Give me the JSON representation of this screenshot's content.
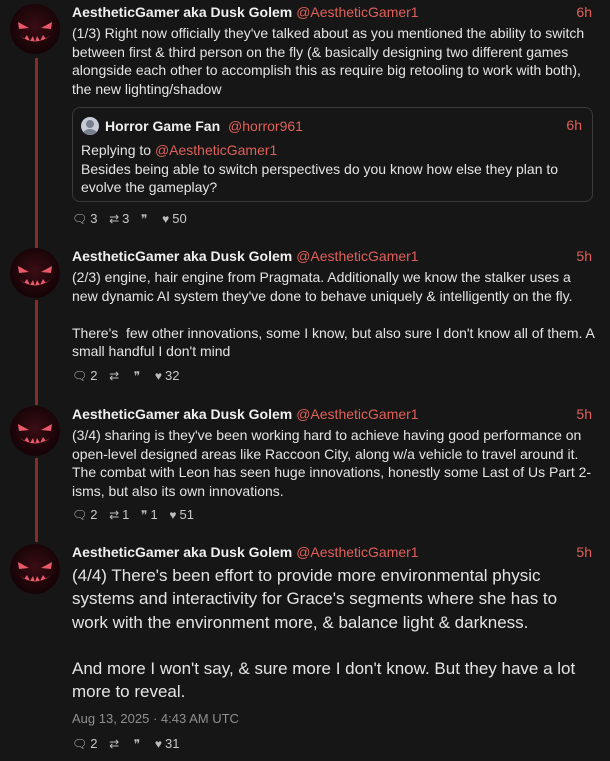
{
  "tweets": [
    {
      "name": "AestheticGamer aka Dusk Golem",
      "handle": "@AestheticGamer1",
      "time": "6h",
      "text": "(1/3) Right now officially they've talked about as you mentioned the ability to switch between first & third person on the fly (& basically designing two different games alongside each other to accomplish this as require big retooling to work with both), the new lighting/shadow",
      "quote": {
        "name": "Horror Game Fan",
        "handle": "@horror961",
        "time": "6h",
        "replying_label": "Replying to",
        "replying_handle": "@AestheticGamer1",
        "text": "Besides being able to switch perspectives do you know how else they plan to evolve the gameplay?"
      },
      "stats": {
        "replies": "3",
        "retweets": "3",
        "quotes": "",
        "likes": "50"
      }
    },
    {
      "name": "AestheticGamer aka Dusk Golem",
      "handle": "@AestheticGamer1",
      "time": "5h",
      "text": "(2/3) engine, hair engine from Pragmata. Additionally we know the stalker uses a new dynamic AI system they've done to behave uniquely & intelligently on the fly.\n\nThere's  few other innovations, some I know, but also sure I don't know all of them. A small handful I don't mind",
      "stats": {
        "replies": "2",
        "retweets": "",
        "quotes": "",
        "likes": "32"
      }
    },
    {
      "name": "AestheticGamer aka Dusk Golem",
      "handle": "@AestheticGamer1",
      "time": "5h",
      "text": "(3/4) sharing is they've been working hard to achieve having good performance on open-level designed areas like Raccoon City, along w/a vehicle to travel around it. The combat with Leon has seen huge innovations, honestly some Last of Us Part 2-isms, but also its own innovations.",
      "stats": {
        "replies": "2",
        "retweets": "1",
        "quotes": "1",
        "likes": "51"
      }
    },
    {
      "name": "AestheticGamer aka Dusk Golem",
      "handle": "@AestheticGamer1",
      "time": "5h",
      "text": "(4/4) There's been effort to provide more environmental physic systems and interactivity for Grace's segments where she has to work with the environment more, & balance light & darkness.\n\nAnd more I won't say, & sure more I don't know. But they have a lot more to reveal.",
      "date": "Aug 13, 2025 · 4:43 AM UTC",
      "stats": {
        "replies": "2",
        "retweets": "",
        "quotes": "",
        "likes": "31"
      }
    }
  ],
  "icons": {
    "reply": "comment-icon",
    "retweet": "retweet-icon",
    "quote": "quote-icon",
    "like": "heart-icon"
  },
  "colors": {
    "background": "#161616",
    "accent": "#e0605a",
    "thread_line": "#8a2a2a"
  }
}
